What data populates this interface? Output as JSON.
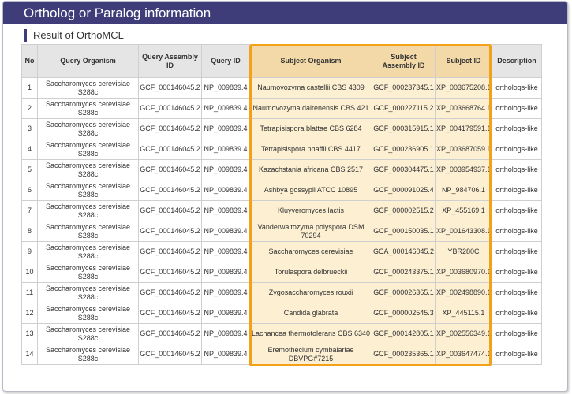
{
  "header": {
    "title": "Ortholog or Paralog information"
  },
  "section": {
    "title": "Result of OrthoMCL"
  },
  "table": {
    "columns": [
      "No",
      "Query Organism",
      "Query Assembly ID",
      "Query ID",
      "Subject Organism",
      "Subject Assembly ID",
      "Subject ID",
      "Description"
    ],
    "rows": [
      {
        "no": "1",
        "query_organism": "Saccharomyces cerevisiae S288c",
        "query_assembly": "GCF_000146045.2",
        "query_id": "NP_009839.4",
        "subject_organism": "Naumovozyma castellii CBS 4309",
        "subject_assembly": "GCF_000237345.1",
        "subject_id": "XP_003675208.1",
        "description": "orthologs-like"
      },
      {
        "no": "2",
        "query_organism": "Saccharomyces cerevisiae S288c",
        "query_assembly": "GCF_000146045.2",
        "query_id": "NP_009839.4",
        "subject_organism": "Naumovozyma dairenensis CBS 421",
        "subject_assembly": "GCF_000227115.2",
        "subject_id": "XP_003668764.1",
        "description": "orthologs-like"
      },
      {
        "no": "3",
        "query_organism": "Saccharomyces cerevisiae S288c",
        "query_assembly": "GCF_000146045.2",
        "query_id": "NP_009839.4",
        "subject_organism": "Tetrapisispora blattae CBS 6284",
        "subject_assembly": "GCF_000315915.1",
        "subject_id": "XP_004179591.1",
        "description": "orthologs-like"
      },
      {
        "no": "4",
        "query_organism": "Saccharomyces cerevisiae S288c",
        "query_assembly": "GCF_000146045.2",
        "query_id": "NP_009839.4",
        "subject_organism": "Tetrapisispora phaffii CBS 4417",
        "subject_assembly": "GCF_000236905.1",
        "subject_id": "XP_003687059.1",
        "description": "orthologs-like"
      },
      {
        "no": "5",
        "query_organism": "Saccharomyces cerevisiae S288c",
        "query_assembly": "GCF_000146045.2",
        "query_id": "NP_009839.4",
        "subject_organism": "Kazachstania africana CBS 2517",
        "subject_assembly": "GCF_000304475.1",
        "subject_id": "XP_003954937.1",
        "description": "orthologs-like"
      },
      {
        "no": "6",
        "query_organism": "Saccharomyces cerevisiae S288c",
        "query_assembly": "GCF_000146045.2",
        "query_id": "NP_009839.4",
        "subject_organism": "Ashbya gossypii ATCC 10895",
        "subject_assembly": "GCF_000091025.4",
        "subject_id": "NP_984706.1",
        "description": "orthologs-like"
      },
      {
        "no": "7",
        "query_organism": "Saccharomyces cerevisiae S288c",
        "query_assembly": "GCF_000146045.2",
        "query_id": "NP_009839.4",
        "subject_organism": "Kluyveromyces lactis",
        "subject_assembly": "GCF_000002515.2",
        "subject_id": "XP_455169.1",
        "description": "orthologs-like"
      },
      {
        "no": "8",
        "query_organism": "Saccharomyces cerevisiae S288c",
        "query_assembly": "GCF_000146045.2",
        "query_id": "NP_009839.4",
        "subject_organism": "Vanderwaltozyma polyspora DSM 70294",
        "subject_assembly": "GCF_000150035.1",
        "subject_id": "XP_001643308.1",
        "description": "orthologs-like"
      },
      {
        "no": "9",
        "query_organism": "Saccharomyces cerevisiae S288c",
        "query_assembly": "GCF_000146045.2",
        "query_id": "NP_009839.4",
        "subject_organism": "Saccharomyces cerevisiae",
        "subject_assembly": "GCA_000146045.2",
        "subject_id": "YBR280C",
        "description": "orthologs-like"
      },
      {
        "no": "10",
        "query_organism": "Saccharomyces cerevisiae S288c",
        "query_assembly": "GCF_000146045.2",
        "query_id": "NP_009839.4",
        "subject_organism": "Torulaspora delbrueckii",
        "subject_assembly": "GCF_000243375.1",
        "subject_id": "XP_003680970.1",
        "description": "orthologs-like"
      },
      {
        "no": "11",
        "query_organism": "Saccharomyces cerevisiae S288c",
        "query_assembly": "GCF_000146045.2",
        "query_id": "NP_009839.4",
        "subject_organism": "Zygosaccharomyces rouxii",
        "subject_assembly": "GCF_000026365.1",
        "subject_id": "XP_002498890.1",
        "description": "orthologs-like"
      },
      {
        "no": "12",
        "query_organism": "Saccharomyces cerevisiae S288c",
        "query_assembly": "GCF_000146045.2",
        "query_id": "NP_009839.4",
        "subject_organism": "Candida glabrata",
        "subject_assembly": "GCF_000002545.3",
        "subject_id": "XP_445115.1",
        "description": "orthologs-like"
      },
      {
        "no": "13",
        "query_organism": "Saccharomyces cerevisiae S288c",
        "query_assembly": "GCF_000146045.2",
        "query_id": "NP_009839.4",
        "subject_organism": "Lachancea thermotolerans CBS 6340",
        "subject_assembly": "GCF_000142805.1",
        "subject_id": "XP_002556349.1",
        "description": "orthologs-like"
      },
      {
        "no": "14",
        "query_organism": "Saccharomyces cerevisiae S288c",
        "query_assembly": "GCF_000146045.2",
        "query_id": "NP_009839.4",
        "subject_organism": "Eremothecium cymbalariae DBVPG#7215",
        "subject_assembly": "GCF_000235365.1",
        "subject_id": "XP_003647474.1",
        "description": "orthologs-like"
      }
    ]
  },
  "colors": {
    "header_bg": "#3e3d7a",
    "highlight_border": "#f3a118",
    "highlight_fill": "#fcefd2",
    "highlight_header_fill": "#f3d9a8"
  }
}
